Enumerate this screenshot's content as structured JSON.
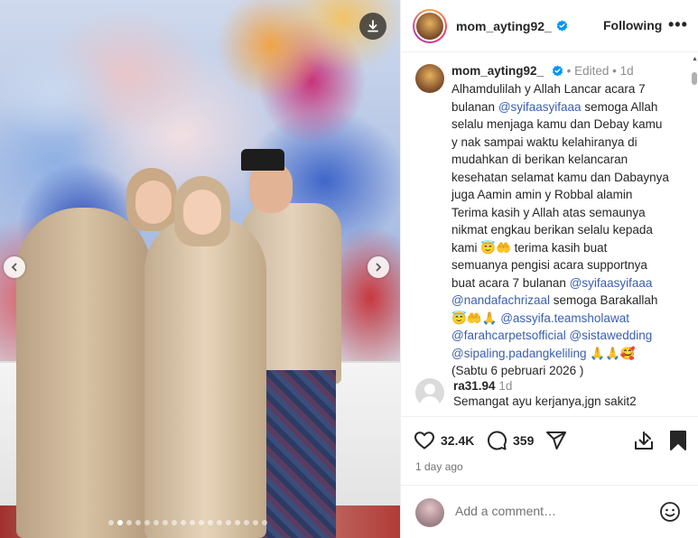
{
  "post": {
    "author": "mom_ayting92_",
    "follow_status": "Following",
    "more_label": "•••",
    "edited": "Edited",
    "separator": "•",
    "time": "1d",
    "caption": [
      {
        "t": "Alhamdulilah y Allah Lancar acara 7\nbulanan "
      },
      {
        "t": "@syifaasyifaaa",
        "m": true
      },
      {
        "t": " semoga Allah\nselalu menjaga kamu dan Debay kamu\ny nak sampai waktu kelahiranya di\nmudahkan di berikan kelancaran\nkesehatan selamat kamu dan Dabaynya\njuga Aamin amin y Robbal alamin\nTerima kasih y Allah atas semaunya\nnikmat engkau berikan selalu kepada\nkami 😇🤲 terima kasih buat\nsemuanya pengisi acara supportnya\nbuat acara 7 bulanan "
      },
      {
        "t": "@syifaasyifaaa",
        "m": true
      },
      {
        "t": "\n"
      },
      {
        "t": "@nandafachrizaal",
        "m": true
      },
      {
        "t": " semoga Barakallah\n😇🤲🙏 "
      },
      {
        "t": "@assyifa.teamsholawat",
        "m": true
      },
      {
        "t": "\n"
      },
      {
        "t": "@farahcarpetsofficial",
        "m": true
      },
      {
        "t": " "
      },
      {
        "t": "@sistawedding",
        "m": true
      },
      {
        "t": "\n"
      },
      {
        "t": "@sipaling.padangkeliling",
        "m": true
      },
      {
        "t": " 🙏🙏🥰\n(Sabtu 6 pebruari 2026 )"
      }
    ]
  },
  "comments": [
    {
      "user": "ra31.94",
      "time": "1d",
      "text": "Semangat ayu kerjanya,jgn sakit2"
    }
  ],
  "stats": {
    "likes": "32.4K",
    "comments": "359",
    "time_ago": "1 day ago"
  },
  "add_comment": {
    "placeholder": "Add a comment…"
  },
  "carousel": {
    "total": 18,
    "active_index": 1
  },
  "colors": {
    "mention": "#3a5fae",
    "verified": "#0095f6",
    "meta": "#8e8e8e"
  }
}
